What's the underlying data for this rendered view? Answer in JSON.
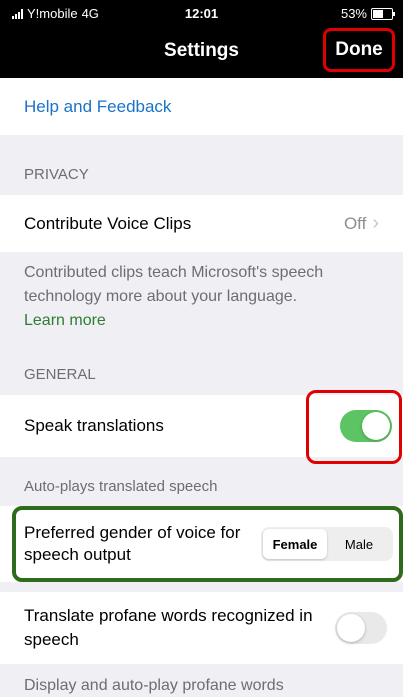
{
  "status_bar": {
    "carrier": "Y!mobile",
    "network": "4G",
    "time": "12:01",
    "battery": "53%",
    "battery_level": 0.53
  },
  "nav": {
    "title": "Settings",
    "done": "Done"
  },
  "help": {
    "label": "Help and Feedback"
  },
  "privacy": {
    "header": "PRIVACY",
    "contribute_label": "Contribute Voice Clips",
    "contribute_value": "Off",
    "description": "Contributed clips teach Microsoft's speech technology more about your language.",
    "learn_more": "Learn more"
  },
  "general": {
    "header": "GENERAL",
    "speak_label": "Speak translations",
    "speak_on": true,
    "speak_desc": "Auto-plays translated speech",
    "gender_label": "Preferred gender of voice for speech output",
    "gender_options": [
      "Female",
      "Male"
    ],
    "gender_selected": "Female",
    "profane_label": "Translate profane words recognized in speech",
    "profane_on": false,
    "profane_desc": "Display and auto-play profane words"
  },
  "colors": {
    "link": "#1a73c9",
    "toggle_on": "#5cc463",
    "highlight_red": "#e00000",
    "highlight_green": "#2f6b1c"
  }
}
